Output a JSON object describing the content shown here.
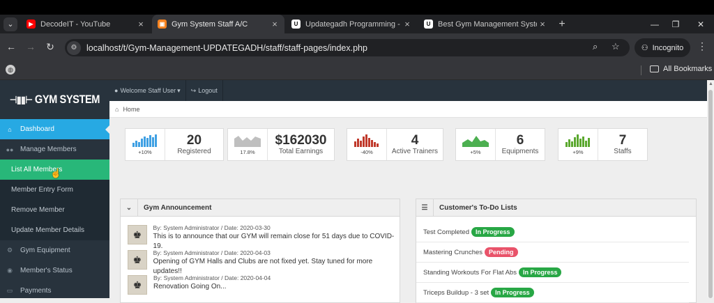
{
  "browser": {
    "tabs": [
      {
        "title": "DecodeIT - YouTube",
        "icon": "youtube-icon",
        "color": "#ff0000",
        "active": false
      },
      {
        "title": "Gym System Staff A/C",
        "icon": "gym-favicon-icon",
        "color": "#f5821f",
        "active": true
      },
      {
        "title": "Updategadh Programming - Up",
        "icon": "updategadh-favicon-icon",
        "color": "#ffffff",
        "active": false
      },
      {
        "title": "Best Gym Management System",
        "icon": "updategadh-favicon-icon",
        "color": "#ffffff",
        "active": false
      }
    ],
    "tab_close": "×",
    "new_tab": "+",
    "url": "localhost/t/Gym-Management-UPDATEGADH/staff/staff-pages/index.php",
    "incognito_label": "Incognito",
    "bookmarks_label": "All Bookmarks"
  },
  "app": {
    "logo_text": "GYM SYSTEM",
    "topbar": {
      "welcome": "Welcome Staff User",
      "logout": "Logout"
    },
    "breadcrumb": "Home",
    "sidebar": {
      "items": [
        {
          "label": "Dashboard",
          "icon": "home-icon"
        },
        {
          "label": "Manage Members",
          "icon": "users-icon"
        }
      ],
      "sub_items": [
        {
          "label": "List All Members"
        },
        {
          "label": "Member Entry Form"
        },
        {
          "label": "Remove Member"
        },
        {
          "label": "Update Member Details"
        }
      ],
      "items_after": [
        {
          "label": "Gym Equipment",
          "icon": "cogs-icon"
        },
        {
          "label": "Member's Status",
          "icon": "eye-icon"
        },
        {
          "label": "Payments",
          "icon": "money-icon"
        }
      ]
    },
    "stats": [
      {
        "value": "20",
        "label": "Registered",
        "pct": "+10%",
        "color": "#3fa0e3",
        "chart": "bar"
      },
      {
        "value": "$162030",
        "label": "Total Earnings",
        "pct": "17.8%",
        "color": "#bfbfbf",
        "chart": "area"
      },
      {
        "value": "4",
        "label": "Active Trainers",
        "pct": "-40%",
        "color": "#c0392b",
        "chart": "bar"
      },
      {
        "value": "6",
        "label": "Equipments",
        "pct": "+5%",
        "color": "#4caf50",
        "chart": "area"
      },
      {
        "value": "7",
        "label": "Staffs",
        "pct": "+9%",
        "color": "#5ba82f",
        "chart": "bar"
      }
    ],
    "announcements": {
      "title": "Gym Announcement",
      "items": [
        {
          "meta": "By: System Administrator / Date: 2020-03-30",
          "message": "This is to announce that our GYM will remain close for 51 days due to COVID-19."
        },
        {
          "meta": "By: System Administrator / Date: 2020-04-03",
          "message": "Opening of GYM Halls and Clubs are not fixed yet. Stay tuned for more updates!!"
        },
        {
          "meta": "By: System Administrator / Date: 2020-04-04",
          "message": "Renovation Going On..."
        }
      ]
    },
    "todo": {
      "title": "Customer's To-Do Lists",
      "items": [
        {
          "task": "Test Completed",
          "status": "In Progress",
          "status_color": "#28a745"
        },
        {
          "task": "Mastering Crunches",
          "status": "Pending",
          "status_color": "#e9536a"
        },
        {
          "task": "Standing Workouts For Flat Abs",
          "status": "In Progress",
          "status_color": "#28a745"
        },
        {
          "task": "Triceps Buildup - 3 set",
          "status": "In Progress",
          "status_color": "#28a745"
        }
      ]
    }
  }
}
